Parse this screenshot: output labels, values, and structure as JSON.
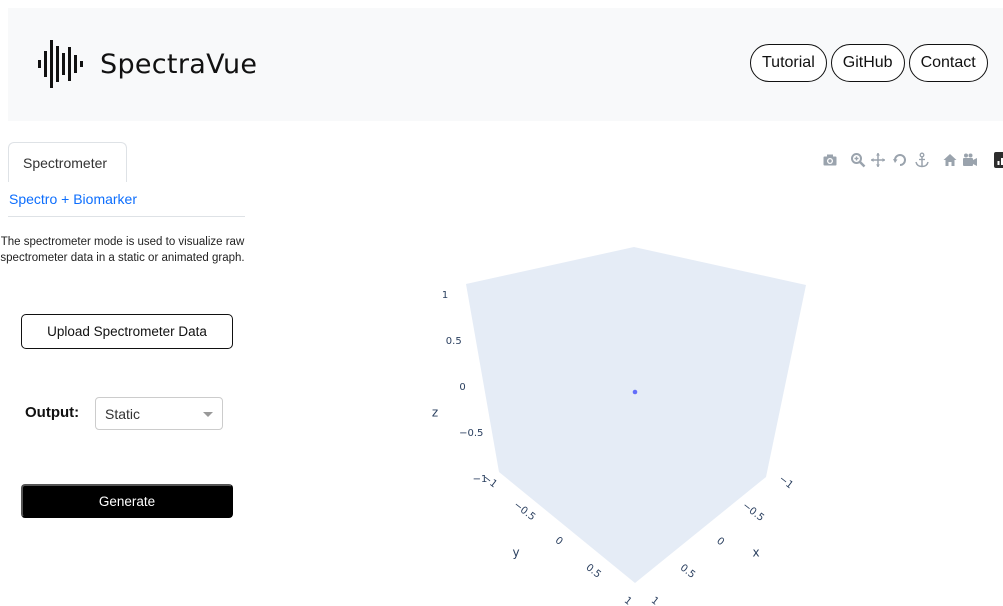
{
  "app": {
    "name": "SpectraVue"
  },
  "icons": {
    "logo": "waveform-icon",
    "dropdown": "chevron-down-icon"
  },
  "nav": [
    {
      "label": "Tutorial"
    },
    {
      "label": "GitHub"
    },
    {
      "label": "Contact"
    }
  ],
  "tabs": {
    "active": "Spectrometer",
    "secondary": "Spectro + Biomarker"
  },
  "description": "The spectrometer mode is used to visualize raw spectrometer data in a static or animated graph.",
  "upload_button": "Upload Spectrometer Data",
  "output": {
    "label": "Output:",
    "selected": "Static"
  },
  "generate_button": "Generate",
  "modebar": [
    "camera-icon",
    "zoom-icon",
    "pan-icon",
    "orbit-rotation-icon",
    "turntable-rotation-icon",
    "reset-camera-icon",
    "last-saved-camera-icon",
    "plotly-logo-icon"
  ],
  "colors": {
    "scene_bg": "#e5ecf6",
    "tick_text": "#2a3f5f",
    "point": "#636efa",
    "link": "#0d6efd"
  },
  "chart_data": {
    "type": "scatter",
    "dims": 3,
    "points": [
      {
        "x": 0,
        "y": 0,
        "z": 0
      }
    ],
    "axes": {
      "x": {
        "label": "x",
        "range": [
          -1,
          1
        ],
        "ticks": [
          "−1",
          "−0.5",
          "0",
          "0.5",
          "1"
        ]
      },
      "y": {
        "label": "y",
        "range": [
          -1,
          1
        ],
        "ticks": [
          "−1",
          "−0.5",
          "0",
          "0.5",
          "1"
        ]
      },
      "z": {
        "label": "z",
        "range": [
          -1,
          1
        ],
        "ticks": [
          "−1",
          "−0.5",
          "0",
          "0.5",
          "1"
        ]
      }
    }
  }
}
